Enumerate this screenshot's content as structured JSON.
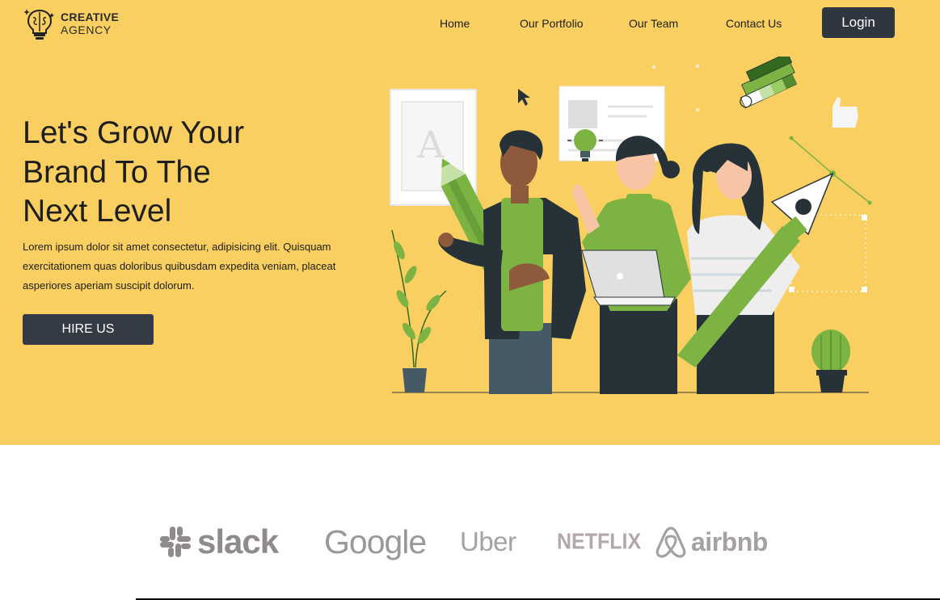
{
  "brand": {
    "line1": "CREATIVE",
    "line2": "AGENCY",
    "icon": "brain-bulb-icon"
  },
  "nav": {
    "items": [
      {
        "label": "Home"
      },
      {
        "label": "Our Portfolio"
      },
      {
        "label": "Our Team"
      },
      {
        "label": "Contact Us"
      }
    ],
    "login_label": "Login"
  },
  "hero": {
    "title_lines": [
      "Let's Grow Your",
      "Brand To The",
      "Next Level"
    ],
    "description": "Lorem ipsum dolor sit amet consectetur, adipisicing elit. Quisquam exercitationem quas doloribus quibusdam expedita veniam, placeat asperiores aperiam suscipit dolorum.",
    "cta_label": "HIRE US",
    "illustration_letter": "A"
  },
  "partners": [
    {
      "name": "slack",
      "icon": "slack-logo-icon"
    },
    {
      "name": "Google"
    },
    {
      "name": "Uber"
    },
    {
      "name": "NETFLIX"
    },
    {
      "name": "airbnb",
      "icon": "airbnb-logo-icon"
    }
  ],
  "colors": {
    "hero_bg": "#f9cf61",
    "button_dark": "#2f3640",
    "illustration_green": "#7cb342",
    "illustration_dark": "#263238"
  }
}
